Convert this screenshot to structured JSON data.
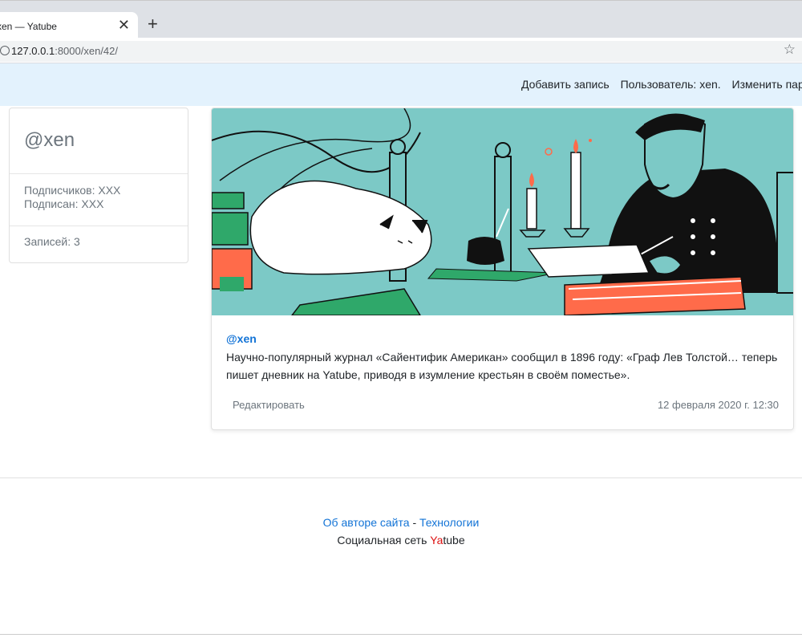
{
  "browser": {
    "tab_title": "xen — Yatube",
    "close_glyph": "✕",
    "new_tab_glyph": "+",
    "url_host": "127.0.0.1",
    "url_path": ":8000/xen/42/",
    "star_glyph": "☆"
  },
  "navbar": {
    "add_post": "Добавить запись",
    "user": "Пользователь: xen.",
    "change_password": "Изменить пароль"
  },
  "profile": {
    "username": "@xen",
    "followers": "Подписчиков: XXX",
    "following": "Подписан: XXX",
    "posts": "Записей: 3"
  },
  "post": {
    "author": "@xen",
    "text": "Научно-популярный журнал «Сайентифик Американ» сообщил в 1896 году: «Граф Лев Толстой… теперь пишет дневник на Yatube, приводя в изумление крестьян в своём поместье».",
    "edit_label": "Редактировать",
    "date": "12 февраля 2020 г. 12:30"
  },
  "footer": {
    "about_author": "Об авторе сайта",
    "separator": "-",
    "technologies": "Технологии",
    "tagline_prefix": "Социальная сеть ",
    "brand_red": "Ya",
    "brand_rest": "tube"
  },
  "colors": {
    "navbar_bg": "#e3f2fd",
    "link": "#1273d6",
    "brand_red": "#dd1111",
    "illustration_bg": "#7cc9c6"
  }
}
